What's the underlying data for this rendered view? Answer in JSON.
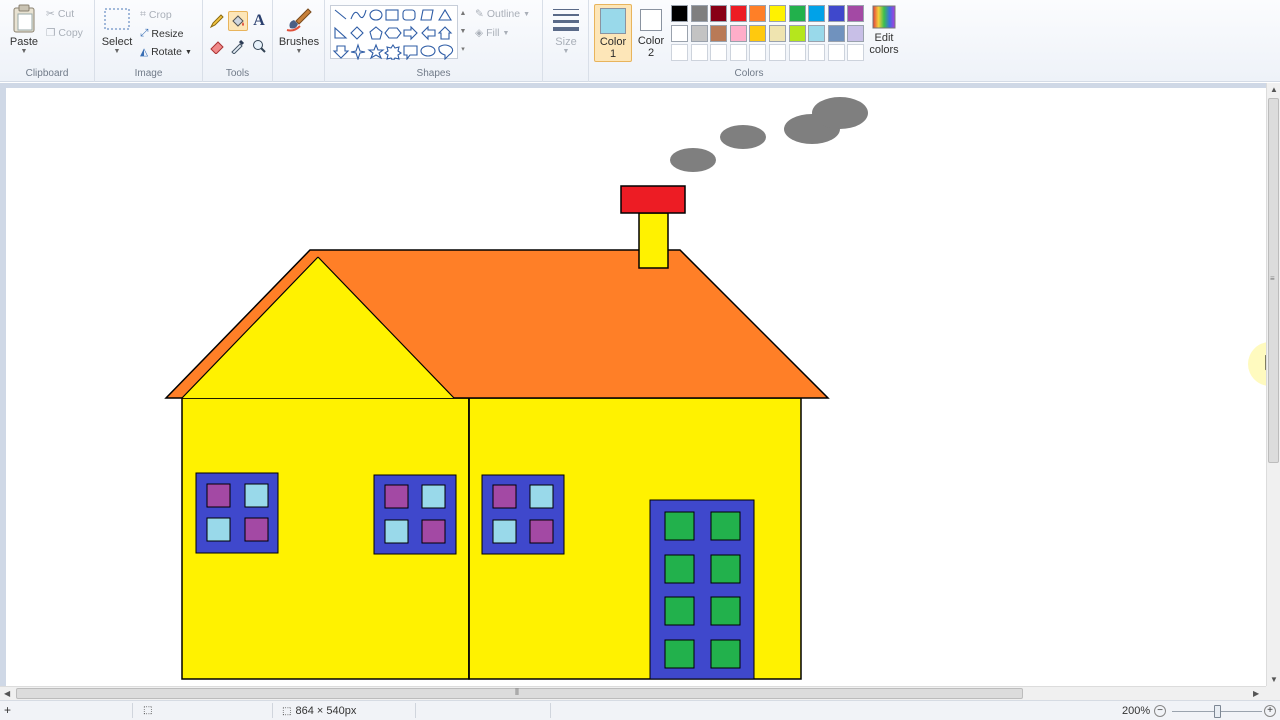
{
  "ribbon": {
    "clipboard": {
      "label": "Clipboard",
      "paste": "Paste",
      "cut": "Cut",
      "copy": "Copy"
    },
    "image": {
      "label": "Image",
      "select": "Select",
      "crop": "Crop",
      "resize": "Resize",
      "rotate": "Rotate"
    },
    "tools": {
      "label": "Tools",
      "text_glyph": "A"
    },
    "brushes": {
      "label": "Brushes"
    },
    "shapes": {
      "label": "Shapes",
      "outline": "Outline",
      "fill": "Fill"
    },
    "size": {
      "label": "Size"
    },
    "colors": {
      "label": "Colors",
      "color1_label": "Color",
      "color1_num": "1",
      "color1_value": "#99d9ea",
      "color2_label": "Color",
      "color2_num": "2",
      "color2_value": "#ffffff",
      "edit_label": "Edit",
      "edit_label2": "colors",
      "palette_row1": [
        "#000000",
        "#7f7f7f",
        "#880015",
        "#ed1c24",
        "#ff7f27",
        "#fff200",
        "#22b14c",
        "#00a2e8",
        "#3f48cc",
        "#a349a4"
      ],
      "palette_row2": [
        "#ffffff",
        "#c3c3c3",
        "#b97a57",
        "#ffaec9",
        "#ffc90e",
        "#efe4b0",
        "#b5e61d",
        "#99d9ea",
        "#7092be",
        "#c8bfe7"
      ]
    }
  },
  "drawing": {
    "wall_color": "#fff200",
    "roof_color": "#ff7f27",
    "chimney_top_color": "#ed1c24",
    "smoke_color": "#7f7f7f",
    "window_frame_color": "#3f48cc",
    "window_pane_a": "#a349a4",
    "window_pane_b": "#99d9ea",
    "door_pane_color": "#22b14c"
  },
  "status": {
    "canvas_size": "864 × 540px",
    "zoom": "200%"
  }
}
